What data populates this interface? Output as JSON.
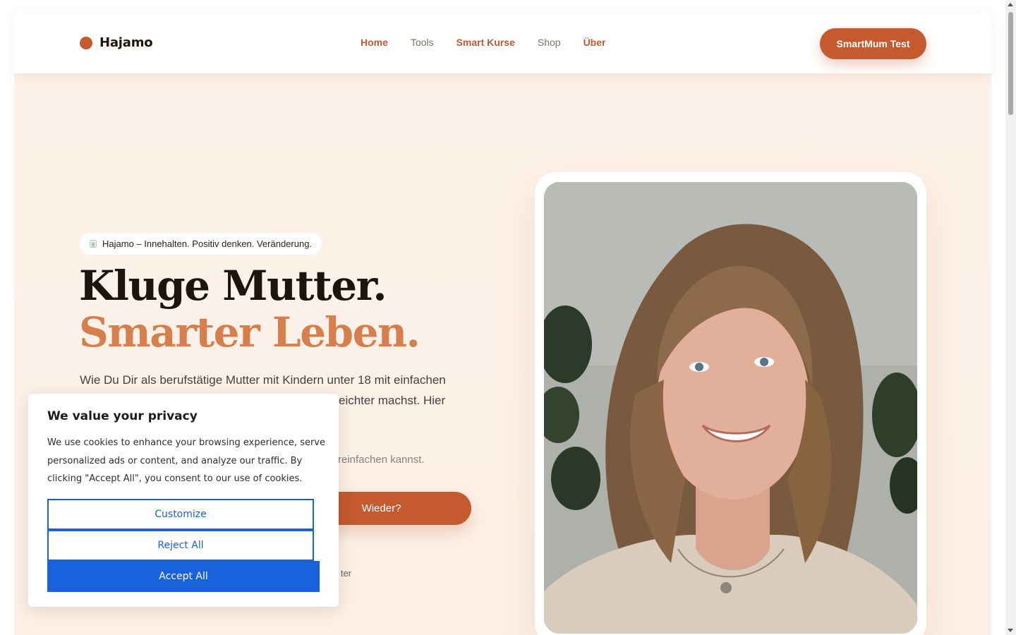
{
  "header": {
    "logo_text": "Hajamo",
    "nav": [
      {
        "label": "Home",
        "active": true
      },
      {
        "label": "Tools",
        "active": false
      },
      {
        "label": "Smart Kurse",
        "active": true
      },
      {
        "label": "Shop",
        "active": false
      },
      {
        "label": "Über",
        "active": true
      }
    ],
    "cta_label": "SmartMum Test"
  },
  "hero": {
    "tagline": "Hajamo – Innehalten. Positiv denken. Veränderung.",
    "headline_line1": "Kluge Mutter.",
    "headline_line2": "Smarter Leben.",
    "lead_line1": "Wie Du Dir als berufstätige Mutter mit Kindern unter 18 mit einfachen",
    "lead_line2_visible": "eichter machst. Hier",
    "sub_visible": "reinfachen kannst.",
    "button_visible": "Wieder?",
    "footnote_visible": "ter"
  },
  "cookie": {
    "title": "We value your privacy",
    "text": "We use cookies to enhance your browsing experience, serve personalized ads or content, and analyze our traffic. By clicking \"Accept All\", you consent to our use of cookies.",
    "customize_label": "Customize",
    "reject_label": "Reject All",
    "accept_label": "Accept All"
  },
  "colors": {
    "accent": "#c45a2d",
    "headline_accent": "#d67f4d",
    "cookie_blue": "#1863dc",
    "hero_bg": "#fdf2e9"
  }
}
